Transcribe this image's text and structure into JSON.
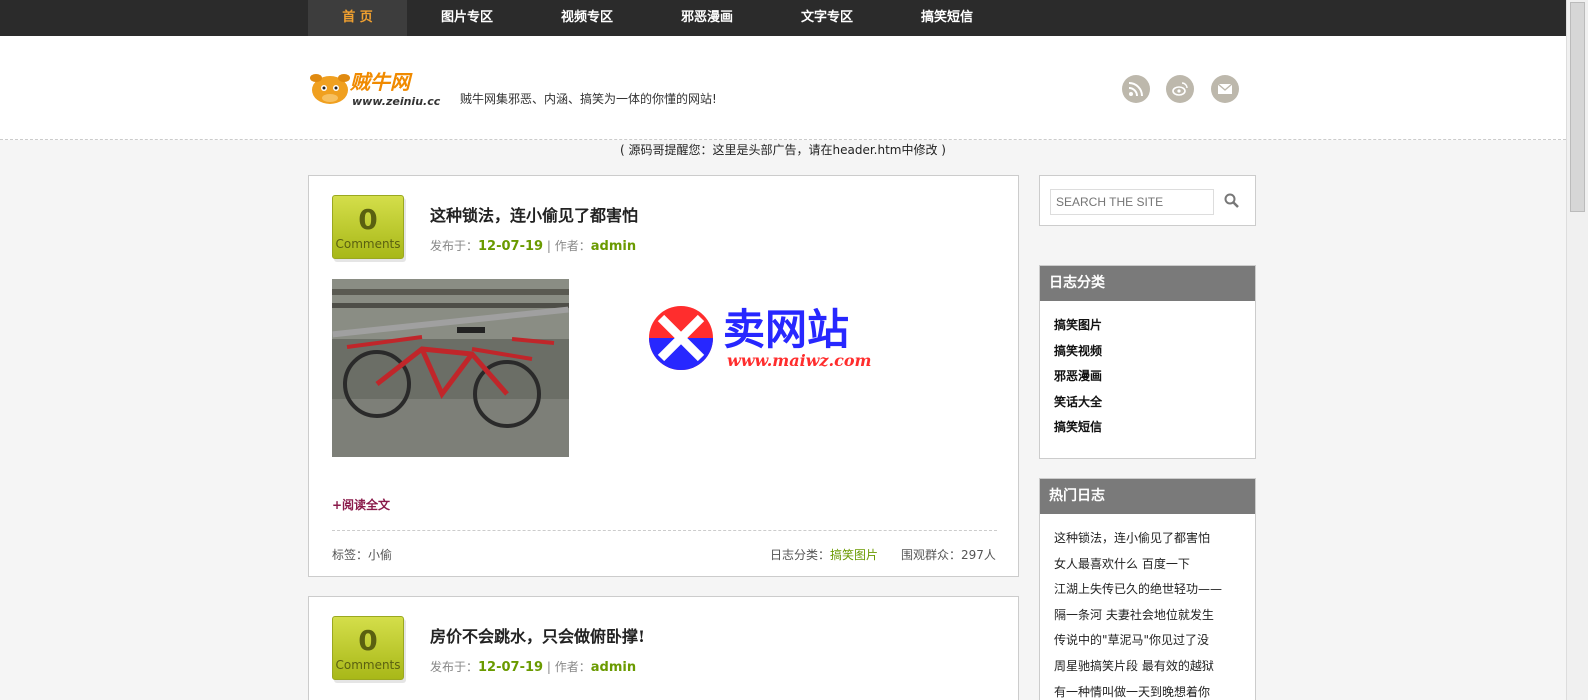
{
  "nav": {
    "items": [
      {
        "label": "首 页",
        "active": true
      },
      {
        "label": "图片专区",
        "active": false
      },
      {
        "label": "视频专区",
        "active": false
      },
      {
        "label": "邪恶漫画",
        "active": false
      },
      {
        "label": "文字专区",
        "active": false
      },
      {
        "label": "搞笑短信",
        "active": false
      }
    ]
  },
  "header": {
    "logo_text": "贼牛网",
    "logo_url": "www.zeiniu.cc",
    "tagline": "贼牛网集邪恶、内涵、搞笑为一体的你懂的网站!",
    "social_icons": [
      "rss-icon",
      "weibo-icon",
      "mail-icon"
    ]
  },
  "ad_notice": "( 源码哥提醒您：这里是头部广告，请在header.htm中修改 )",
  "posts": [
    {
      "comments_count": "0",
      "comments_label": "Comments",
      "title": "这种锁法，连小偷见了都害怕",
      "meta_published_label": "发布于：",
      "date": "12-07-19",
      "meta_author_label": "| 作者：",
      "author": "admin",
      "watermark_cn": "卖网站",
      "watermark_url": "www.maiwz.com",
      "read_more": "+阅读全文",
      "tags": "标签：小偷",
      "category_label": "日志分类：",
      "category": "搞笑图片",
      "views": "围观群众：297人"
    },
    {
      "comments_count": "0",
      "comments_label": "Comments",
      "title": "房价不会跳水，只会做俯卧撑!",
      "meta_published_label": "发布于：",
      "date": "12-07-19",
      "meta_author_label": "| 作者：",
      "author": "admin"
    }
  ],
  "search": {
    "placeholder": "SEARCH THE SITE"
  },
  "sidebar": {
    "categories_title": "日志分类",
    "categories": [
      "搞笑图片",
      "搞笑视频",
      "邪恶漫画",
      "笑话大全",
      "搞笑短信"
    ],
    "hot_title": "热门日志",
    "hot": [
      "这种锁法，连小偷见了都害怕",
      "女人最喜欢什么 百度一下",
      "江湖上失传已久的绝世轻功——",
      "隔一条河 夫妻社会地位就发生",
      "传说中的\"草泥马\"你见过了没",
      "周星驰搞笑片段 最有效的越狱",
      "有一种情叫做一天到晚想着你"
    ]
  },
  "colors": {
    "nav_bg": "#2b2b2b",
    "nav_active": "#f0a030",
    "accent_green": "#6a9a00",
    "readmore": "#8a1a4a",
    "widget_head": "#7a7a7a"
  }
}
